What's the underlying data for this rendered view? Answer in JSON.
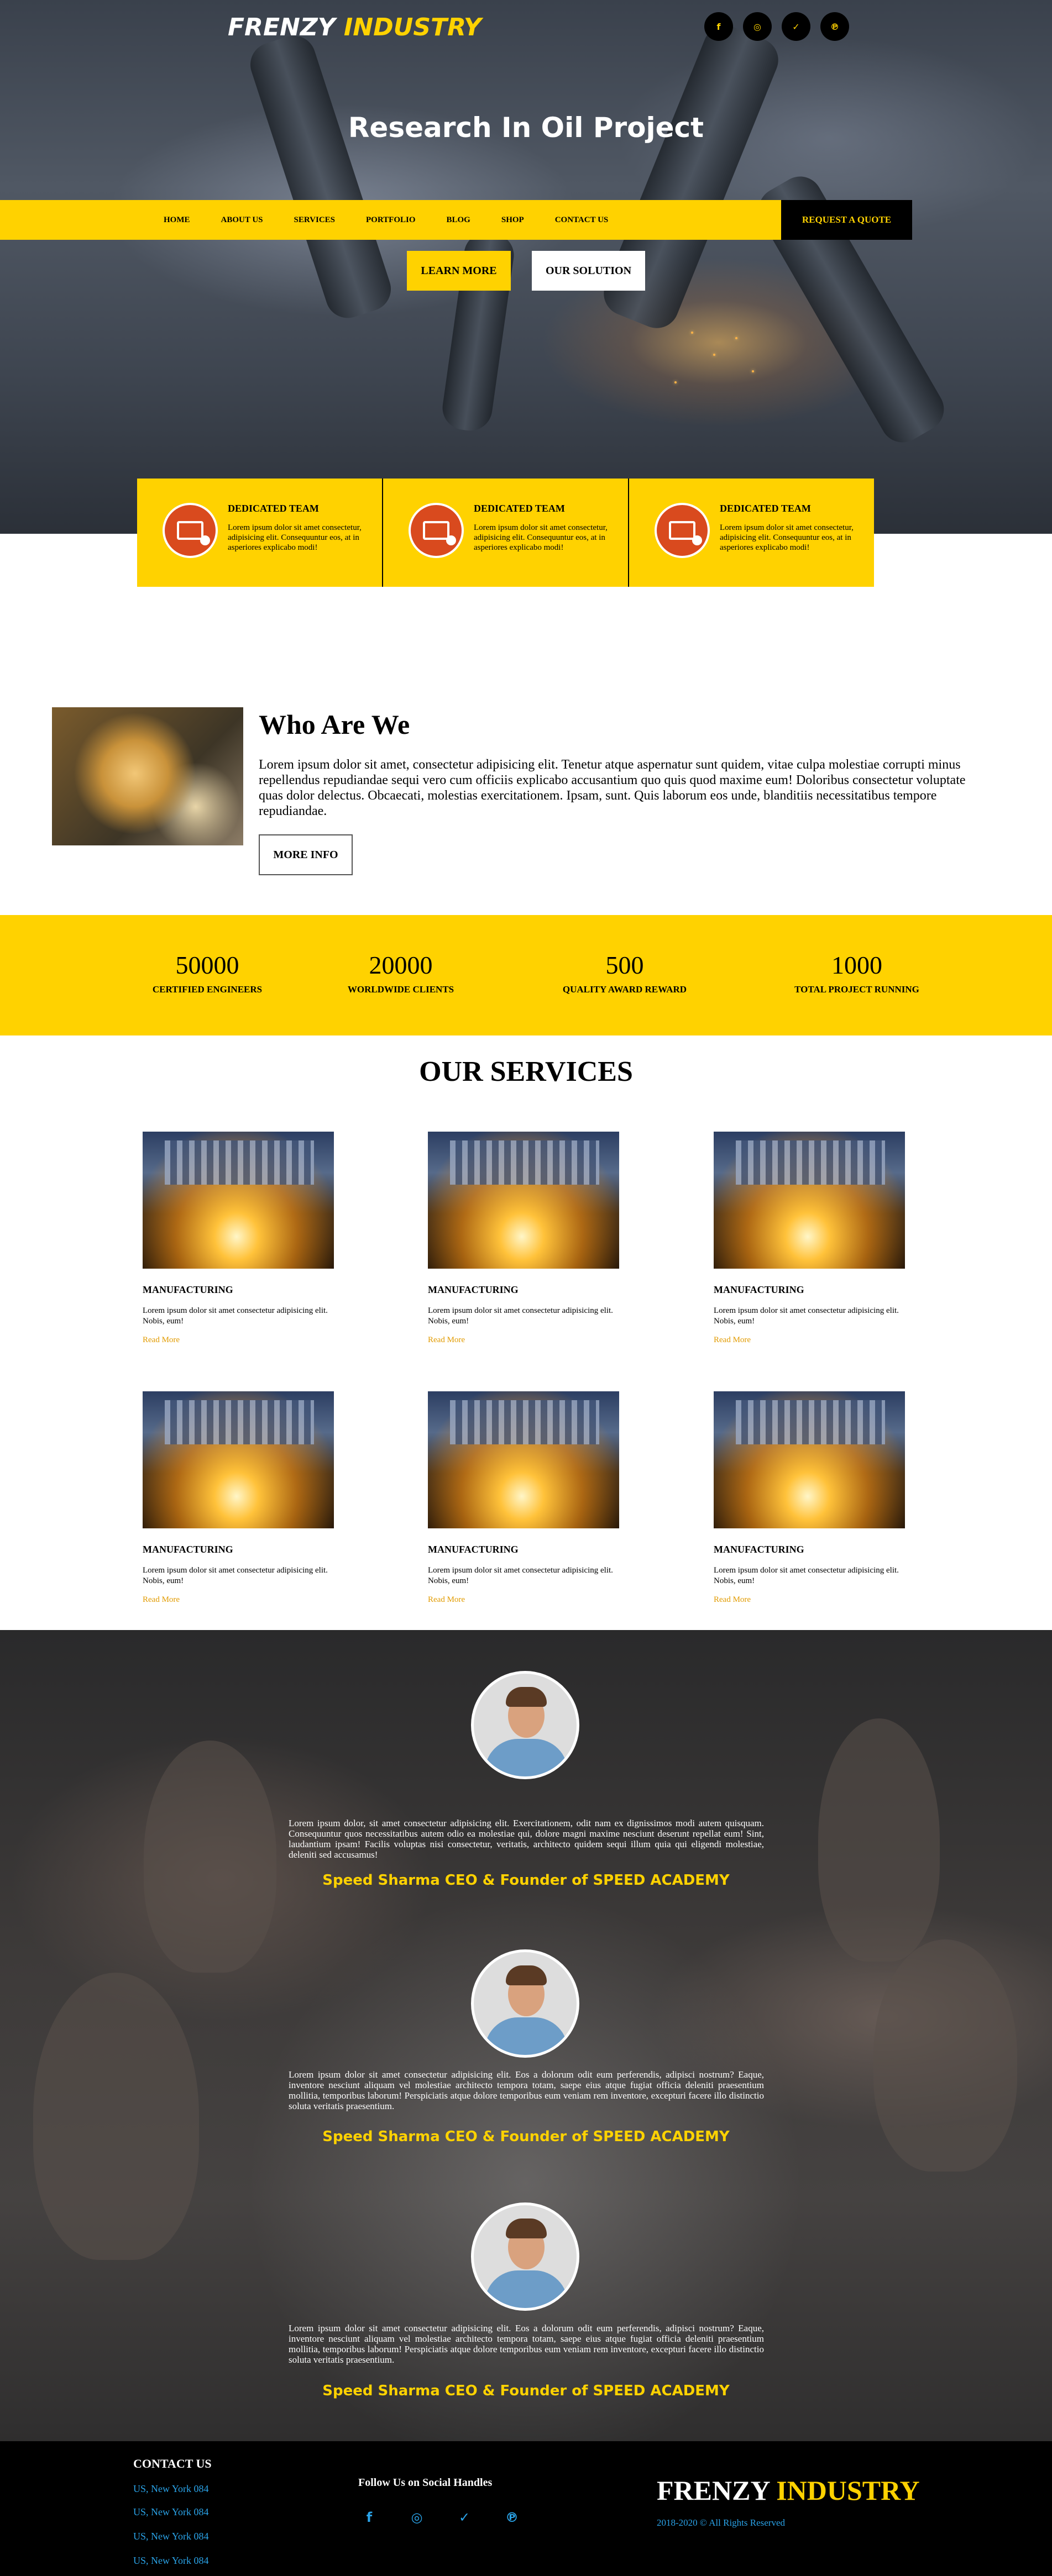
{
  "brand": {
    "name": "FRENZY",
    "accent": "INDUSTRY",
    "accent_color": "#ffd200"
  },
  "social_top": [
    {
      "icon": "facebook-icon",
      "glyph": "f"
    },
    {
      "icon": "instagram-icon",
      "glyph": "◎"
    },
    {
      "icon": "twitter-icon",
      "glyph": "✓"
    },
    {
      "icon": "pinterest-icon",
      "glyph": "℗"
    }
  ],
  "hero": {
    "title": "Research In Oil Project",
    "learn_more": "LEARN MORE",
    "our_solution": "OUR SOLUTION"
  },
  "nav": {
    "items": [
      "HOME",
      "ABOUT US",
      "SERVICES",
      "PORTFOLIO",
      "BLOG",
      "SHOP",
      "CONTACT US"
    ],
    "cta": "REQUEST A QUOTE"
  },
  "features": [
    {
      "title": "DEDICATED TEAM",
      "text": "Lorem ipsum dolor sit amet consectetur, adipisicing elit. Consequuntur eos, at in asperiores explicabo modi!"
    },
    {
      "title": "DEDICATED TEAM",
      "text": "Lorem ipsum dolor sit amet consectetur, adipisicing elit. Consequuntur eos, at in asperiores explicabo modi!"
    },
    {
      "title": "DEDICATED TEAM",
      "text": "Lorem ipsum dolor sit amet consectetur, adipisicing elit. Consequuntur eos, at in asperiores explicabo modi!"
    }
  ],
  "who": {
    "title": "Who Are We",
    "text": "Lorem ipsum dolor sit amet, consectetur adipisicing elit. Tenetur atque aspernatur sunt quidem, vitae culpa molestiae corrupti minus repellendus repudiandae sequi vero cum officiis explicabo accusantium quo quis quod maxime eum! Doloribus consectetur voluptate quas dolor delectus. Obcaecati, molestias exercitationem. Ipsam, sunt. Quis laborum eos unde, blanditiis necessitatibus tempore repudiandae.",
    "button": "MORE INFO"
  },
  "stats": [
    {
      "value": "50000",
      "label": "CERTIFIED ENGINEERS"
    },
    {
      "value": "20000",
      "label": "WORLDWIDE CLIENTS"
    },
    {
      "value": "500",
      "label": "QUALITY AWARD REWARD"
    },
    {
      "value": "1000",
      "label": "TOTAL PROJECT RUNNING"
    }
  ],
  "services": {
    "title": "OUR SERVICES",
    "items": [
      {
        "name": "MANUFACTURING",
        "text": "Lorem ipsum dolor sit amet consectetur adipisicing elit. Nobis, eum!",
        "link": "Read More"
      },
      {
        "name": "MANUFACTURING",
        "text": "Lorem ipsum dolor sit amet consectetur adipisicing elit. Nobis, eum!",
        "link": "Read More"
      },
      {
        "name": "MANUFACTURING",
        "text": "Lorem ipsum dolor sit amet consectetur adipisicing elit. Nobis, eum!",
        "link": "Read More"
      },
      {
        "name": "MANUFACTURING",
        "text": "Lorem ipsum dolor sit amet consectetur adipisicing elit. Nobis, eum!",
        "link": "Read More"
      },
      {
        "name": "MANUFACTURING",
        "text": "Lorem ipsum dolor sit amet consectetur adipisicing elit. Nobis, eum!",
        "link": "Read More"
      },
      {
        "name": "MANUFACTURING",
        "text": "Lorem ipsum dolor sit amet consectetur adipisicing elit. Nobis, eum!",
        "link": "Read More"
      }
    ]
  },
  "testimonials": [
    {
      "text": "Lorem ipsum dolor, sit amet consectetur adipisicing elit. Exercitationem, odit nam ex dignissimos modi autem quisquam. Consequuntur quos necessitatibus autem odio ea molestiae qui, dolore magni maxime nesciunt deserunt repellat eum! Sint, laudantium ipsam! Facilis voluptas nisi consectetur, veritatis, architecto quidem sequi illum quia qui eligendi molestiae, deleniti sed accusamus!",
      "name": "Speed Sharma CEO & Founder of SPEED ACADEMY"
    },
    {
      "text": "Lorem ipsum dolor sit amet consectetur adipisicing elit. Eos a dolorum odit eum perferendis, adipisci nostrum? Eaque, inventore nesciunt aliquam vel molestiae architecto tempora totam, saepe eius atque fugiat officia deleniti praesentium mollitia, temporibus laborum! Perspiciatis atque dolore temporibus eum veniam rem inventore, excepturi facere illo distinctio soluta veritatis praesentium.",
      "name": "Speed Sharma CEO & Founder of SPEED ACADEMY"
    },
    {
      "text": "Lorem ipsum dolor sit amet consectetur adipisicing elit. Eos a dolorum odit eum perferendis, adipisci nostrum? Eaque, inventore nesciunt aliquam vel molestiae architecto tempora totam, saepe eius atque fugiat officia deleniti praesentium mollitia, temporibus laborum! Perspiciatis atque dolore temporibus eum veniam rem inventore, excepturi facere illo distinctio soluta veritatis praesentium.",
      "name": "Speed Sharma CEO & Founder of SPEED ACADEMY"
    }
  ],
  "footer": {
    "contact_title": "CONTACT US",
    "contacts": [
      "US, New York 084",
      "US, New York 084",
      "US, New York 084",
      "US, New York 084"
    ],
    "follow_title": "Follow Us on Social Handles",
    "social": [
      {
        "icon": "facebook-icon",
        "glyph": "f"
      },
      {
        "icon": "instagram-icon",
        "glyph": "◎"
      },
      {
        "icon": "twitter-icon",
        "glyph": "✓"
      },
      {
        "icon": "pinterest-icon",
        "glyph": "℗"
      }
    ],
    "copyright": "2018-2020 © All Rights Reserved"
  }
}
